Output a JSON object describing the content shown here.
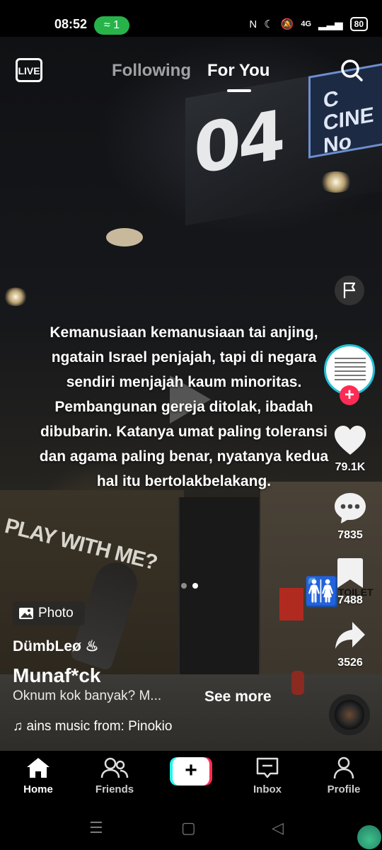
{
  "status_bar": {
    "time": "08:52",
    "hotspot_count": "1",
    "network": "4G",
    "battery": "80"
  },
  "top_nav": {
    "live_label": "LIVE",
    "tab_following": "Following",
    "tab_for_you": "For You"
  },
  "post": {
    "caption": "Kemanusiaan kemanusiaan tai anjing, ngatain Israel penjajah, tapi di negara sendiri menjajah kaum minoritas. Pembangunan gereja ditolak, ibadah dibubarin. Katanya umat paling toleransi dan agama paling benar, nyatanya kedua hal itu bertolakbelakang.",
    "photo_badge": "Photo",
    "username": "DümbLeø ♨",
    "title": "Munaf*ck",
    "description": "Oknum kok banyak? M...",
    "see_more": "See more",
    "music": "♫ ains music from: Pinokio"
  },
  "scene": {
    "sign_number": "04",
    "sign_text": "C\nCINE\nNo",
    "wall_text": "PLAY WITH ME?",
    "toilet_label": "TOILET"
  },
  "actions": {
    "likes": "79.1K",
    "comments": "7835",
    "saves": "7488",
    "shares": "3526",
    "follow_symbol": "+"
  },
  "bottom_nav": {
    "home": "Home",
    "friends": "Friends",
    "create_symbol": "+",
    "inbox": "Inbox",
    "profile": "Profile"
  },
  "colors": {
    "tiktok_red": "#fe2c55",
    "tiktok_cyan": "#25f4ee",
    "hotspot_green": "#27b34a"
  }
}
